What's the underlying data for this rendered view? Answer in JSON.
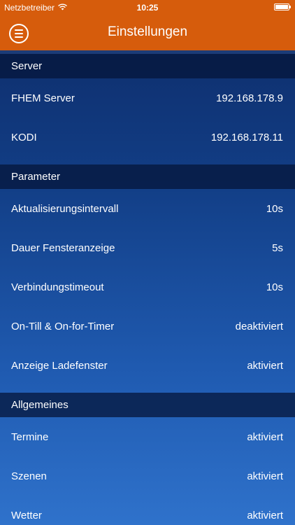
{
  "status_bar": {
    "carrier": "Netzbetreiber",
    "time": "10:25",
    "wifi_icon": "wifi-icon",
    "battery_icon": "battery-icon"
  },
  "nav": {
    "title": "Einstellungen",
    "menu_icon": "menu-icon"
  },
  "colors": {
    "accent": "#d65c0c",
    "background_top": "#0d2a66",
    "background_bottom": "#2f72cb",
    "section_header": "#06163a"
  },
  "sections": [
    {
      "title": "Server",
      "rows": [
        {
          "label": "FHEM Server",
          "value": "192.168.178.9"
        },
        {
          "label": "KODI",
          "value": "192.168.178.11"
        }
      ]
    },
    {
      "title": "Parameter",
      "rows": [
        {
          "label": "Aktualisierungsintervall",
          "value": "10s"
        },
        {
          "label": "Dauer Fensteranzeige",
          "value": "5s"
        },
        {
          "label": "Verbindungstimeout",
          "value": "10s"
        },
        {
          "label": "On-Till & On-for-Timer",
          "value": "deaktiviert"
        },
        {
          "label": "Anzeige Ladefenster",
          "value": "aktiviert"
        }
      ]
    },
    {
      "title": "Allgemeines",
      "rows": [
        {
          "label": "Termine",
          "value": "aktiviert"
        },
        {
          "label": "Szenen",
          "value": "aktiviert"
        },
        {
          "label": "Wetter",
          "value": "aktiviert"
        }
      ]
    }
  ]
}
